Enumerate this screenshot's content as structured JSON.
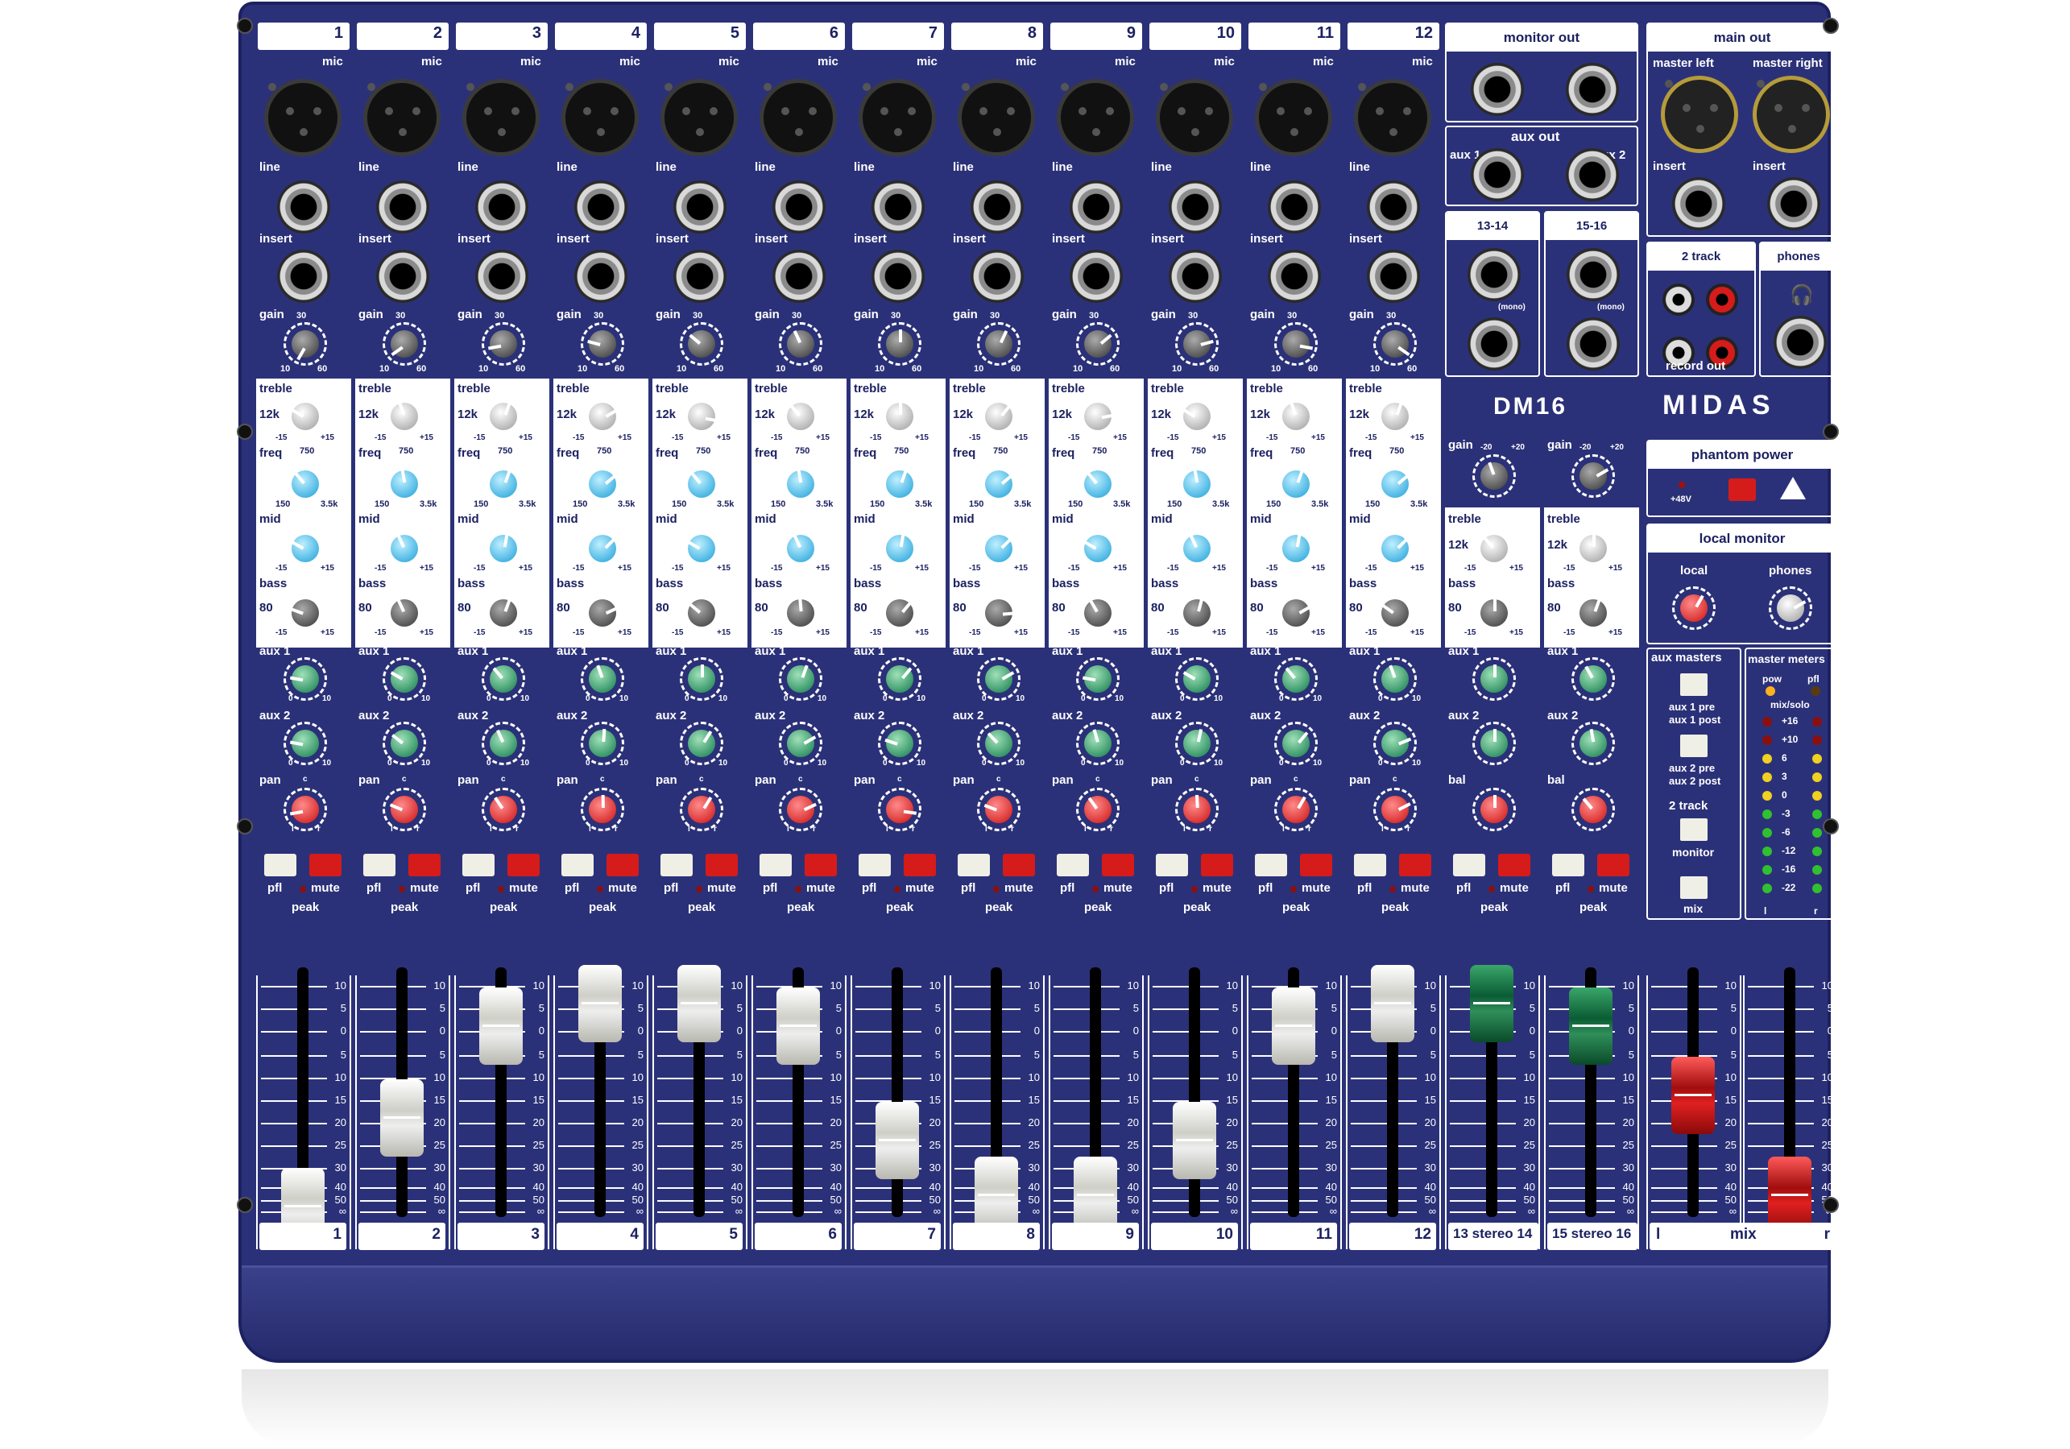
{
  "product": {
    "model": "DM16",
    "brand": "MIDAS"
  },
  "channels": {
    "numbers": [
      "1",
      "2",
      "3",
      "4",
      "5",
      "6",
      "7",
      "8",
      "9",
      "10",
      "11",
      "12"
    ],
    "labels": {
      "mic": "mic",
      "line": "line",
      "insert": "insert",
      "gain": "gain",
      "treble": "treble",
      "freq": "freq",
      "mid": "mid",
      "bass": "bass",
      "aux1": "aux 1",
      "aux2": "aux 2",
      "pan": "pan",
      "pfl": "pfl",
      "mute": "mute",
      "peak": "peak"
    },
    "eq_scale": {
      "gain_low": "10",
      "gain_high": "60",
      "gain_mid": "30",
      "treble_freq": "12k",
      "freq_low": "150",
      "freq_high": "3.5k",
      "freq_mid": "750",
      "bass_freq": "80",
      "cut": "-15",
      "boost": "+15",
      "zero": "0",
      "aux_low": "0",
      "aux_high": "10",
      "pan_l": "l",
      "pan_r": "r",
      "pan_c": "c"
    }
  },
  "stereo_channels": {
    "labels": [
      "13 stereo 14",
      "15 stereo 16"
    ],
    "inputs_labels": [
      "13-14",
      "15-16"
    ],
    "mono": "(mono)",
    "gain_low": "-20",
    "gain_high": "+20",
    "bal": "bal"
  },
  "fader_scale": [
    "10",
    "5",
    "0",
    "5",
    "10",
    "15",
    "20",
    "25",
    "30",
    "40",
    "50",
    "∞"
  ],
  "master": {
    "monitor_out": "monitor out",
    "aux_out": "aux out",
    "aux_1": "aux 1",
    "aux_2": "aux 2",
    "main_out": "main out",
    "master_left": "master left",
    "master_right": "master right",
    "insert": "insert",
    "two_track": "2 track",
    "record_out": "record out",
    "phones": "phones",
    "phantom_power": "phantom power",
    "plus48v": "+48V",
    "local_monitor": "local monitor",
    "local": "local",
    "aux_masters": "aux masters",
    "aux1_pre": "aux 1 pre",
    "aux1_post": "aux 1 post",
    "aux2_pre": "aux 2 pre",
    "aux2_post": "aux 2 post",
    "two_track_monitor": "monitor",
    "mix": "mix",
    "master_meters": "master meters",
    "pow": "pow",
    "pfl": "pfl",
    "mix_solo": "mix/solo",
    "meter_levels": [
      "+16",
      "+10",
      "6",
      "3",
      "0",
      "-3",
      "-6",
      "-12",
      "-16",
      "-22"
    ],
    "l": "l",
    "r": "r",
    "mix_label": "mix"
  },
  "colors": {
    "panel": "#2b3178",
    "knob_blue": "#1a9fd8",
    "knob_green": "#0f7a4a",
    "knob_red": "#cc1111",
    "mute": "#d61b1b"
  },
  "fader_levels_db": {
    "ch": [
      "∞",
      "20",
      "0",
      "-5",
      "-5",
      "0",
      "25",
      "50",
      "50",
      "25",
      "0",
      "-5"
    ],
    "stereo": [
      "-5",
      "0"
    ],
    "mix": [
      "15",
      "50"
    ]
  }
}
